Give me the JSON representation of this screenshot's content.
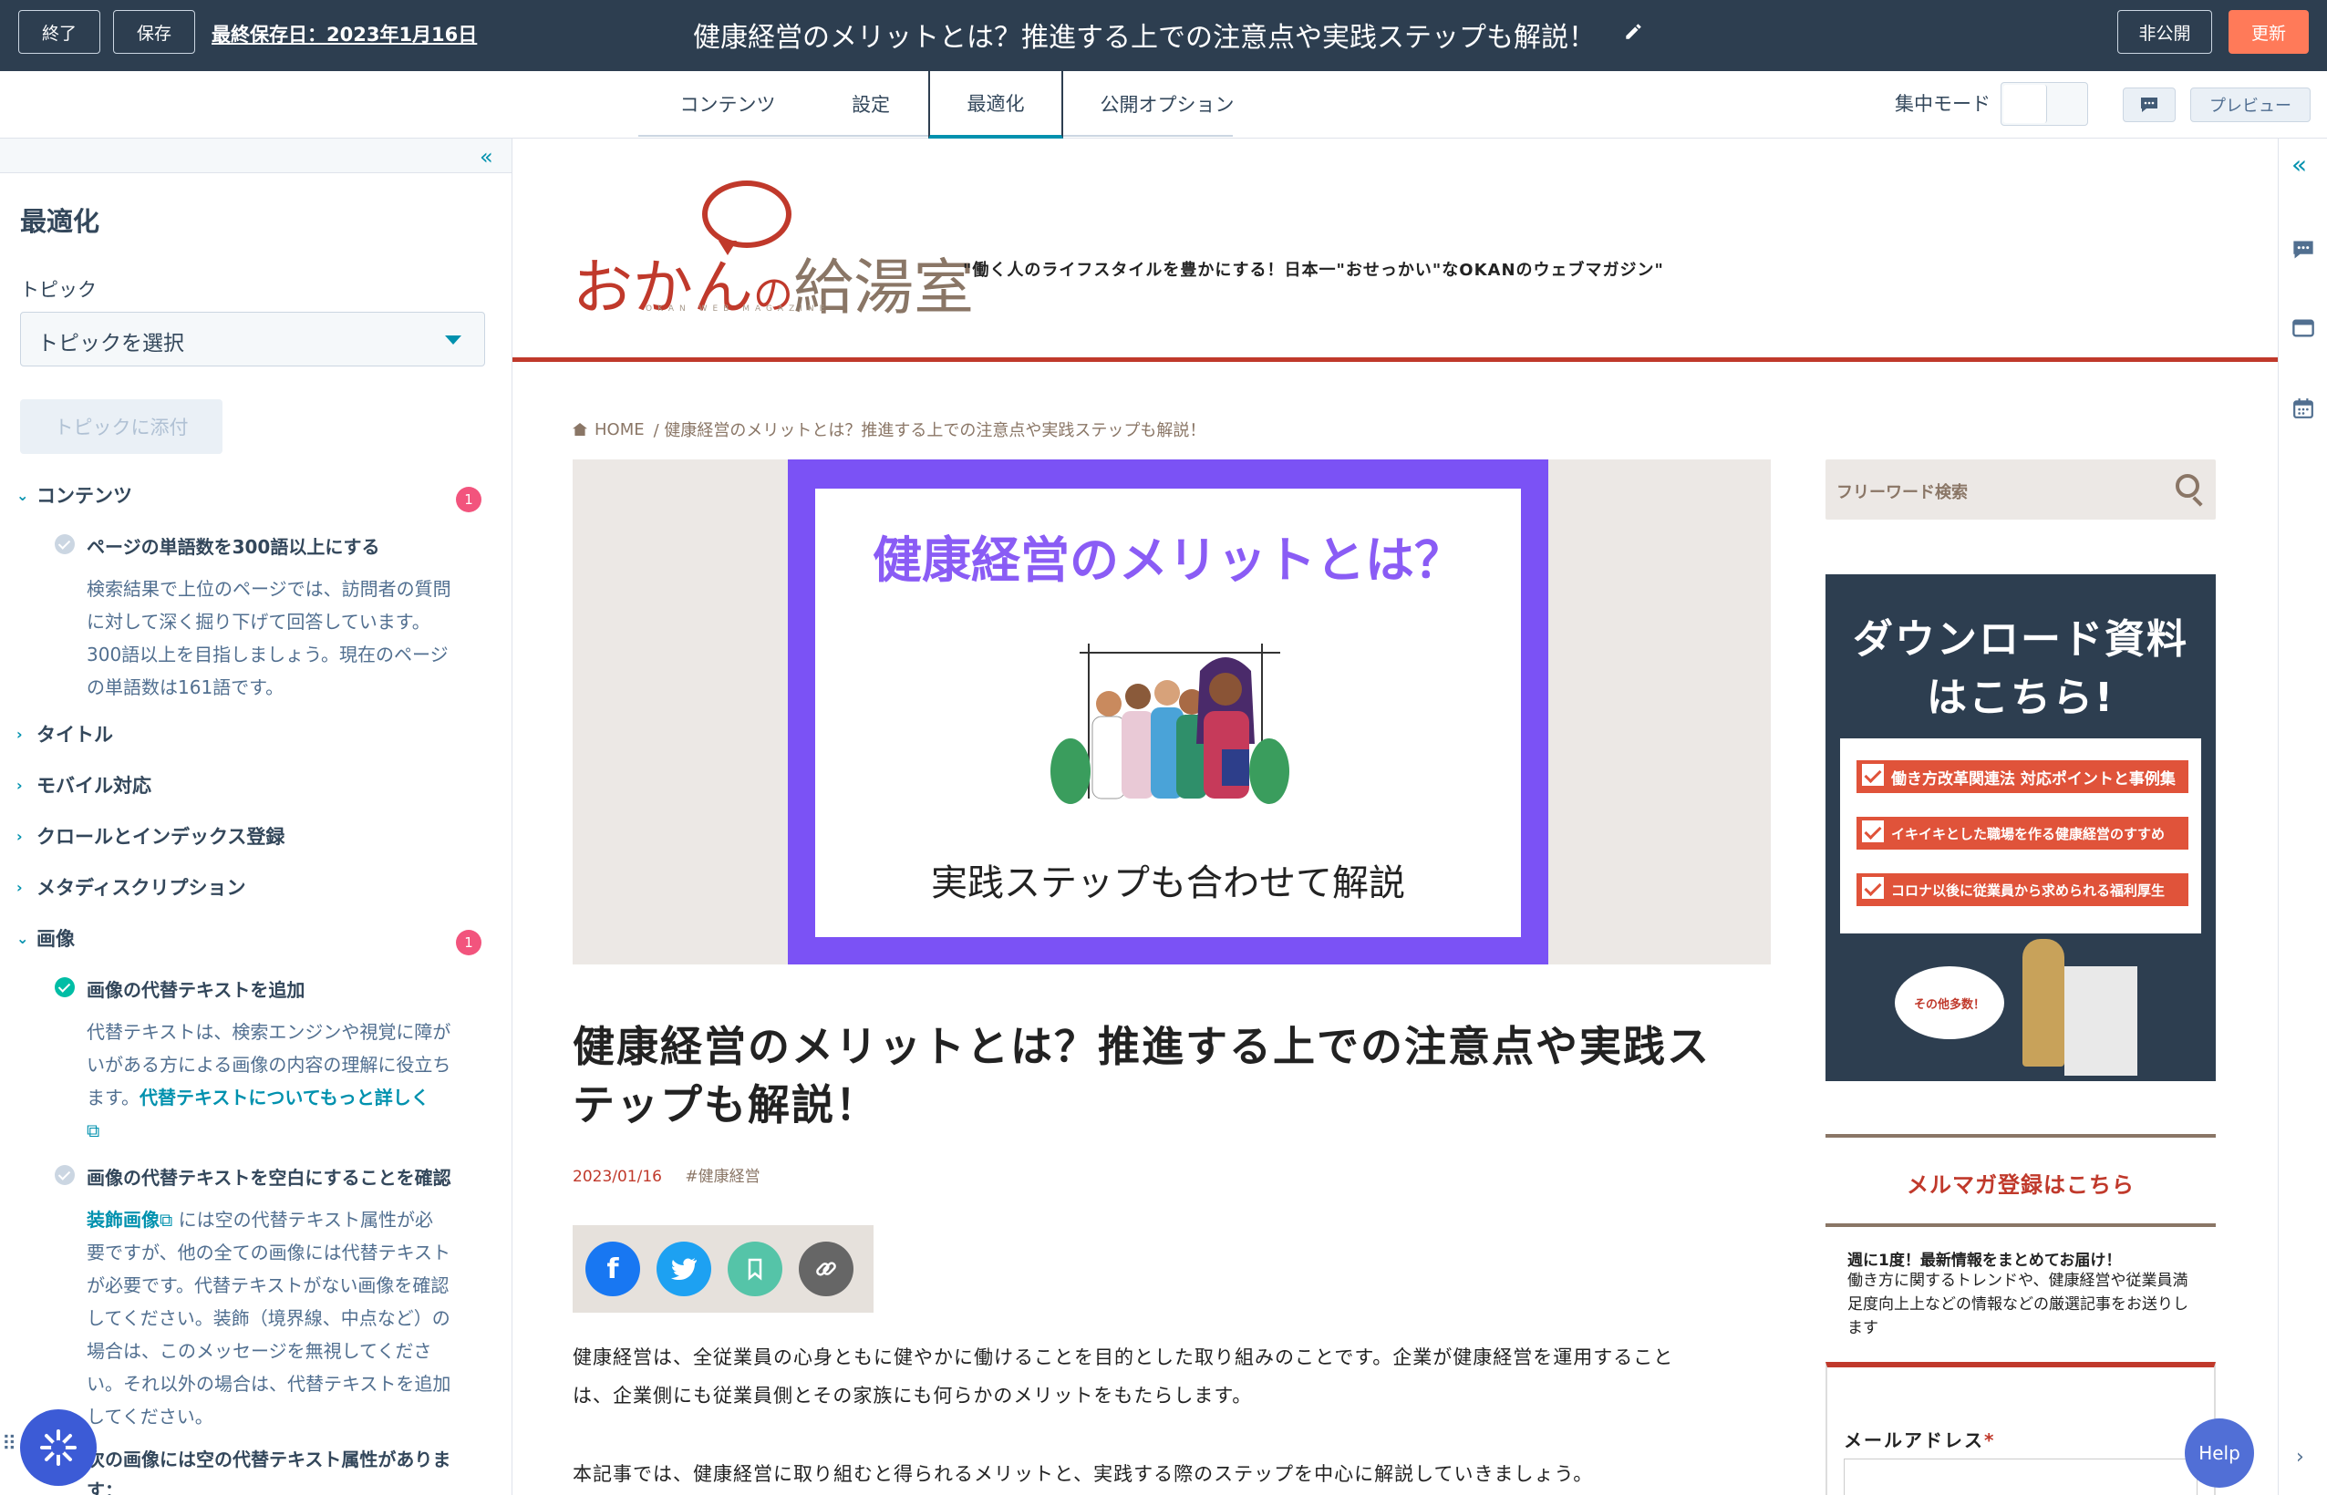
{
  "topbar": {
    "exit_label": "終了",
    "save_label": "保存",
    "last_saved": "最終保存日：2023年1月16日",
    "title": "健康経営のメリットとは？推進する上での注意点や実践ステップも解説！",
    "private_label": "非公開",
    "update_label": "更新"
  },
  "tabs": {
    "items": [
      "コンテンツ",
      "設定",
      "最適化",
      "公開オプション"
    ],
    "active": "最適化",
    "focus_mode": "集中モード",
    "preview_label": "プレビュー"
  },
  "sidebar": {
    "collapse_glyph": "«",
    "title": "最適化",
    "topic_label": "トピック",
    "topic_select": "トピックを選択",
    "attach_label": "トピックに添付",
    "sections": [
      {
        "label": "コンテンツ",
        "expanded": true,
        "badge": "1"
      },
      {
        "label": "タイトル",
        "expanded": false
      },
      {
        "label": "モバイル対応",
        "expanded": false
      },
      {
        "label": "クロールとインデックス登録",
        "expanded": false
      },
      {
        "label": "メタディスクリプション",
        "expanded": false
      },
      {
        "label": "画像",
        "expanded": true,
        "badge": "1"
      }
    ],
    "content_item": {
      "title": "ページの単語数を300語以上にする",
      "lines": [
        "検索結果で上位のページでは、訪問者の質問",
        "に対して深く掘り下げて回答しています。",
        "300語以上を目指しましょう。現在のページ",
        "の単語数は161語です。"
      ]
    },
    "image_item1": {
      "title": "画像の代替テキストを追加",
      "line1": "代替テキストは、検索エンジンや視覚に障が",
      "line2": "いがある方による画像の内容の理解に役立ち",
      "line3_prefix": "ます。",
      "line3_link": "代替テキストについてもっと詳しく"
    },
    "image_item2": {
      "title": "画像の代替テキストを空白にすることを確認",
      "link": "装飾画像",
      "line1_rest": "には空の代替テキスト属性が必",
      "lines": [
        "要ですが、他の全ての画像には代替テキスト",
        "が必要です。代替テキストがない画像を確認",
        "してください。装飾（境界線、中点など）の",
        "場合は、このメッセージを無視してくださ",
        "い。それ以外の場合は、代替テキストを追加",
        "してください。"
      ]
    },
    "image_item3": {
      "line1": "次の画像には空の代替テキスト属性がありま",
      "line2": "す："
    }
  },
  "page": {
    "logo_a": "おかん",
    "logo_no": "の",
    "logo_b": "給湯室",
    "logo_sub": "OKAN WEB MAGAZINE",
    "tagline": "\"働く人のライフスタイルを豊かにする！日本一\"おせっかい\"なOKANのウェブマガジン\"",
    "breadcrumb_home": "HOME",
    "breadcrumb_current": "/ 健康経営のメリットとは？推進する上での注意点や実践ステップも解説！",
    "hero_title": "健康経営のメリットとは？",
    "hero_sub": "実践ステップも合わせて解説",
    "article_title_line1": "健康経営のメリットとは？推進する上での注意点や実践ス",
    "article_title_line2": "テップも解説！",
    "date": "2023/01/16",
    "tag": "#健康経営",
    "para1_line1": "健康経営は、全従業員の心身ともに健やかに働けることを目的とした取り組みのことです。企業が健康経営を運用すること",
    "para1_line2": "は、企業側にも従業員側とその家族にも何らかのメリットをもたらします。",
    "para2": "本記事では、健康経営に取り組むと得られるメリットと、実践する際のステップを中心に解説していきましょう。"
  },
  "page_sidebar": {
    "search_placeholder": "フリーワード検索",
    "dl_title_line1": "ダウンロード資料",
    "dl_title_line2": "はこちら!",
    "dl_rows": [
      "働き方改革関連法 対応ポイントと事例集",
      "イキイキとした職場を作る健康経営のすすめ",
      "コロナ以後に従業員から求められる福利厚生"
    ],
    "dl_cloud": "その他多数！",
    "mail_title": "メルマガ登録はこちら",
    "mail_lead": "週に1度！最新情報をまとめてお届け！",
    "mail_desc": "働き方に関するトレンドや、健康経営や従業員満足度向上上などの情報などの厳選記事をお送りします",
    "mail_label": "メールアドレス",
    "mail_req": "*"
  },
  "help_label": "Help",
  "colors": {
    "topbar": "#2d3e50",
    "accent": "#ff7a59",
    "brand_red": "#c0392b",
    "hero_purple": "#7b52f5",
    "link": "#0091ae"
  }
}
